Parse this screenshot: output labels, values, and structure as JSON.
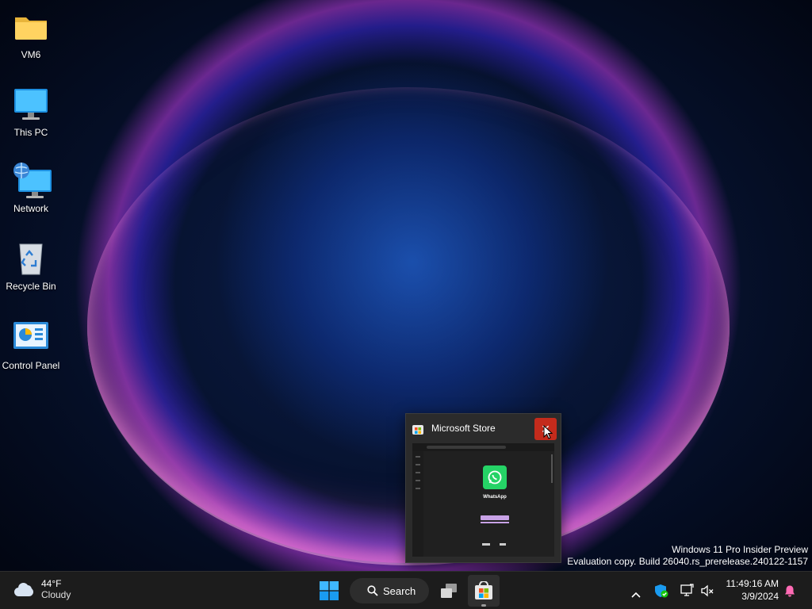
{
  "desktop": {
    "icons": [
      {
        "label": "VM6",
        "icon": "folder-icon"
      },
      {
        "label": "This PC",
        "icon": "computer-icon"
      },
      {
        "label": "Network",
        "icon": "network-icon"
      },
      {
        "label": "Recycle Bin",
        "icon": "recycle-bin-icon"
      },
      {
        "label": "Control Panel",
        "icon": "control-panel-icon"
      }
    ],
    "watermark": {
      "line1": "Windows 11 Pro Insider Preview",
      "line2": "Evaluation copy. Build 26040.rs_prerelease.240122-1157"
    }
  },
  "taskbar": {
    "weather": {
      "temp": "44°F",
      "condition": "Cloudy",
      "icon": "cloud-icon"
    },
    "search_label": "Search",
    "start_icon": "windows-logo-icon",
    "task_view_icon": "task-view-icon",
    "store_icon": "microsoft-store-icon",
    "tray_icons": [
      "chevron-up-icon",
      "windows-security-icon",
      "network-status-icon",
      "speaker-muted-icon"
    ],
    "clock": {
      "time": "11:49:16 AM",
      "date": "3/9/2024"
    },
    "notification_icon": "bell-icon"
  },
  "thumbnail_popup": {
    "title": "Microsoft Store",
    "close_glyph": "✕",
    "preview": {
      "app_name": "WhatsApp"
    }
  },
  "colors": {
    "close_red": "#c42b1c",
    "taskbar_bg": "#1c1c1c",
    "whatsapp_green": "#25d366",
    "accent_blue": "#0078d4"
  }
}
